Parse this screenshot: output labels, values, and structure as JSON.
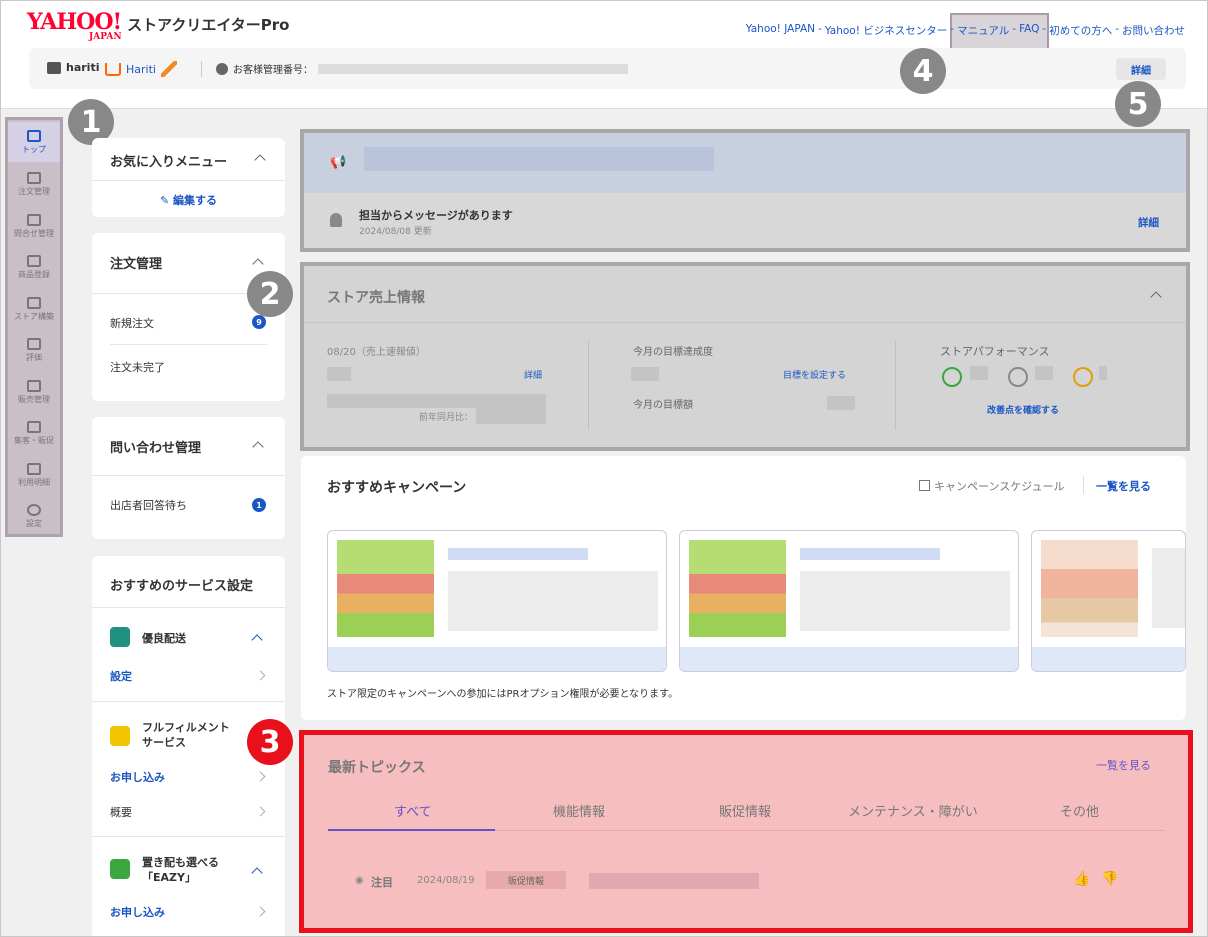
{
  "header": {
    "logo_main": "YAHOO!",
    "logo_sub": "JAPAN",
    "app_name": "ストアクリエイターPro",
    "links": [
      "Yahoo! JAPAN",
      "Yahoo! ビジネスセンター",
      "マニュアル",
      "FAQ",
      "初めての方へ",
      "お問い合わせ"
    ],
    "store_id": "hariti",
    "store_name": "Hariti",
    "customer_no_label": "お客様管理番号：",
    "detail": "詳細"
  },
  "badges": {
    "n1": "1",
    "n2": "2",
    "n3": "3",
    "n4": "4",
    "n5": "5"
  },
  "nav": [
    {
      "label": "トップ",
      "icon": "home-icon",
      "active": true
    },
    {
      "label": "注文管理",
      "icon": "cart-icon"
    },
    {
      "label": "問合せ管理",
      "icon": "chat-icon"
    },
    {
      "label": "商品登録",
      "icon": "edit-icon"
    },
    {
      "label": "ストア構築",
      "icon": "store-icon"
    },
    {
      "label": "評価",
      "icon": "star-icon"
    },
    {
      "label": "販売管理",
      "icon": "bar-chart-icon"
    },
    {
      "label": "集客・販促",
      "icon": "people-icon"
    },
    {
      "label": "利用明細",
      "icon": "coins-icon"
    },
    {
      "label": "設定",
      "icon": "gear-icon"
    }
  ],
  "favorites": {
    "title": "お気に入りメニュー",
    "edit": "編集する"
  },
  "orders": {
    "title": "注文管理",
    "new_orders": "新規注文",
    "new_count": "9",
    "incomplete": "注文未完了"
  },
  "inquiries": {
    "title": "問い合わせ管理",
    "waiting": "出店者回答待ち",
    "waiting_count": "1"
  },
  "services": {
    "title": "おすすめのサービス設定",
    "delivery": {
      "name": "優良配送",
      "setting": "設定"
    },
    "fulfillment": {
      "name1": "フルフィルメント",
      "name2": "サービス",
      "apply": "お申し込み",
      "overview": "概要"
    },
    "eazy": {
      "name1": "置き配も選べる",
      "name2": "「EAZY」",
      "apply": "お申し込み"
    }
  },
  "announce": {
    "message": "担当からメッセージがあります",
    "date": "2024/08/08 更新",
    "detail": "詳細"
  },
  "sales": {
    "title": "ストア売上情報",
    "date_label": "08/20（売上速報値）",
    "detail": "詳細",
    "yoy": "前年同月比：",
    "target_rate": "今月の目標達成度",
    "set_target": "目標を設定する",
    "target_amount": "今月の目標額",
    "performance": "ストアパフォーマンス",
    "improve": "改善点を確認する"
  },
  "campaign": {
    "title": "おすすめキャンペーン",
    "schedule": "キャンペーンスケジュール",
    "view_all": "一覧を見る",
    "note": "ストア限定のキャンペーンへの参加にはPRオプション権限が必要となります。"
  },
  "topics": {
    "title": "最新トピックス",
    "view_all": "一覧を見る",
    "tabs": [
      "すべて",
      "機能情報",
      "販促情報",
      "メンテナンス・障がい",
      "その他"
    ],
    "row": {
      "flag": "注目",
      "date": "2024/08/19",
      "category": "販促情報"
    }
  }
}
